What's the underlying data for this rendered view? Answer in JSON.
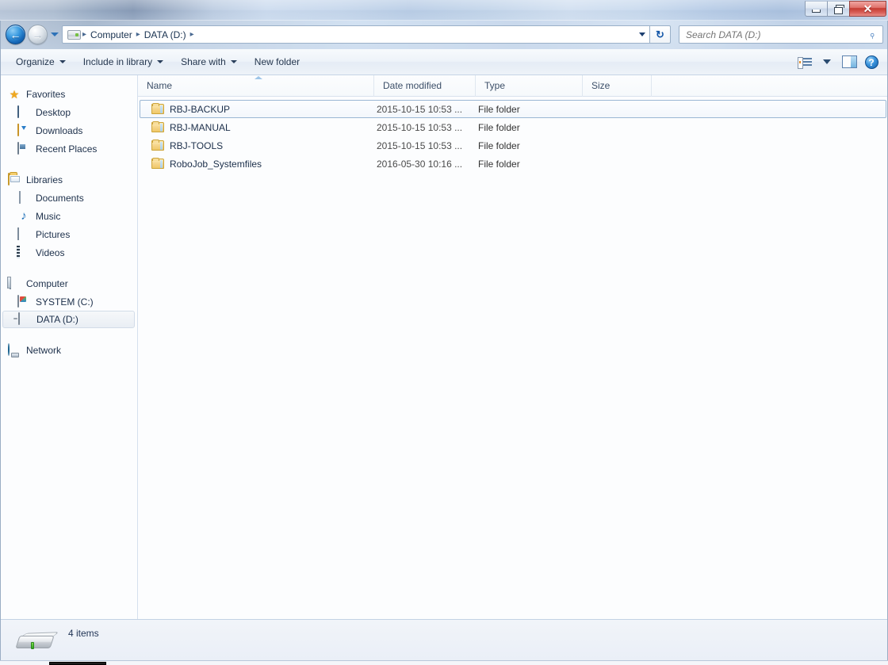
{
  "window": {
    "controls": {
      "minimize": "Minimize",
      "restore": "Restore",
      "close": "Close",
      "close_glyph": "✕"
    }
  },
  "navigation": {
    "back_label": "Back",
    "back_glyph": "←",
    "forward_label": "Forward",
    "forward_glyph": "→",
    "recent_pages_label": "Recent pages",
    "refresh_glyph": "↻",
    "refresh_label": "Refresh"
  },
  "address_bar": {
    "crumbs": [
      "Computer",
      "DATA (D:)"
    ],
    "separator": "▸",
    "dropdown_label": "Previous locations"
  },
  "search": {
    "placeholder": "Search DATA (D:)",
    "value": "",
    "icon": "search-icon",
    "icon_glyph": "⌕"
  },
  "toolbar": {
    "items": [
      {
        "label": "Organize",
        "has_caret": true
      },
      {
        "label": "Include in library",
        "has_caret": true
      },
      {
        "label": "Share with",
        "has_caret": true
      },
      {
        "label": "New folder",
        "has_caret": false
      }
    ],
    "view_label": "Change your view",
    "view_caret_label": "More options",
    "preview_label": "Show the preview pane",
    "help_label": "Get help",
    "help_glyph": "?"
  },
  "sidebar": {
    "groups": [
      {
        "root": {
          "label": "Favorites",
          "icon": "star-icon"
        },
        "items": [
          {
            "label": "Desktop",
            "icon": "desktop-icon"
          },
          {
            "label": "Downloads",
            "icon": "downloads-icon"
          },
          {
            "label": "Recent Places",
            "icon": "recent-places-icon"
          }
        ]
      },
      {
        "root": {
          "label": "Libraries",
          "icon": "libraries-icon"
        },
        "items": [
          {
            "label": "Documents",
            "icon": "documents-icon"
          },
          {
            "label": "Music",
            "icon": "music-icon"
          },
          {
            "label": "Pictures",
            "icon": "pictures-icon"
          },
          {
            "label": "Videos",
            "icon": "videos-icon"
          }
        ]
      },
      {
        "root": {
          "label": "Computer",
          "icon": "computer-icon"
        },
        "items": [
          {
            "label": "SYSTEM (C:)",
            "icon": "system-drive-icon",
            "selected": false
          },
          {
            "label": "DATA (D:)",
            "icon": "data-drive-icon",
            "selected": true
          }
        ]
      },
      {
        "root": {
          "label": "Network",
          "icon": "network-icon"
        },
        "items": []
      }
    ]
  },
  "file_list": {
    "columns": [
      {
        "label": "Name",
        "sorted": true,
        "sort_direction": "ascending"
      },
      {
        "label": "Date modified",
        "sorted": false
      },
      {
        "label": "Type",
        "sorted": false
      },
      {
        "label": "Size",
        "sorted": false
      }
    ],
    "rows": [
      {
        "name": "RBJ-BACKUP",
        "date_modified": "2015-10-15 10:53 ...",
        "type": "File folder",
        "size": "",
        "focused": true
      },
      {
        "name": "RBJ-MANUAL",
        "date_modified": "2015-10-15 10:53 ...",
        "type": "File folder",
        "size": "",
        "focused": false
      },
      {
        "name": "RBJ-TOOLS",
        "date_modified": "2015-10-15 10:53 ...",
        "type": "File folder",
        "size": "",
        "focused": false
      },
      {
        "name": "RoboJob_Systemfiles",
        "date_modified": "2016-05-30 10:16 ...",
        "type": "File folder",
        "size": "",
        "focused": false
      }
    ]
  },
  "status_bar": {
    "item_count_text": "4 items",
    "drive_icon": "hard-drive-icon"
  },
  "colors": {
    "accent": "#2a6ab5",
    "close_button": "#c43c32",
    "folder": "#efc868",
    "selection_border": "#9bb7d4"
  }
}
